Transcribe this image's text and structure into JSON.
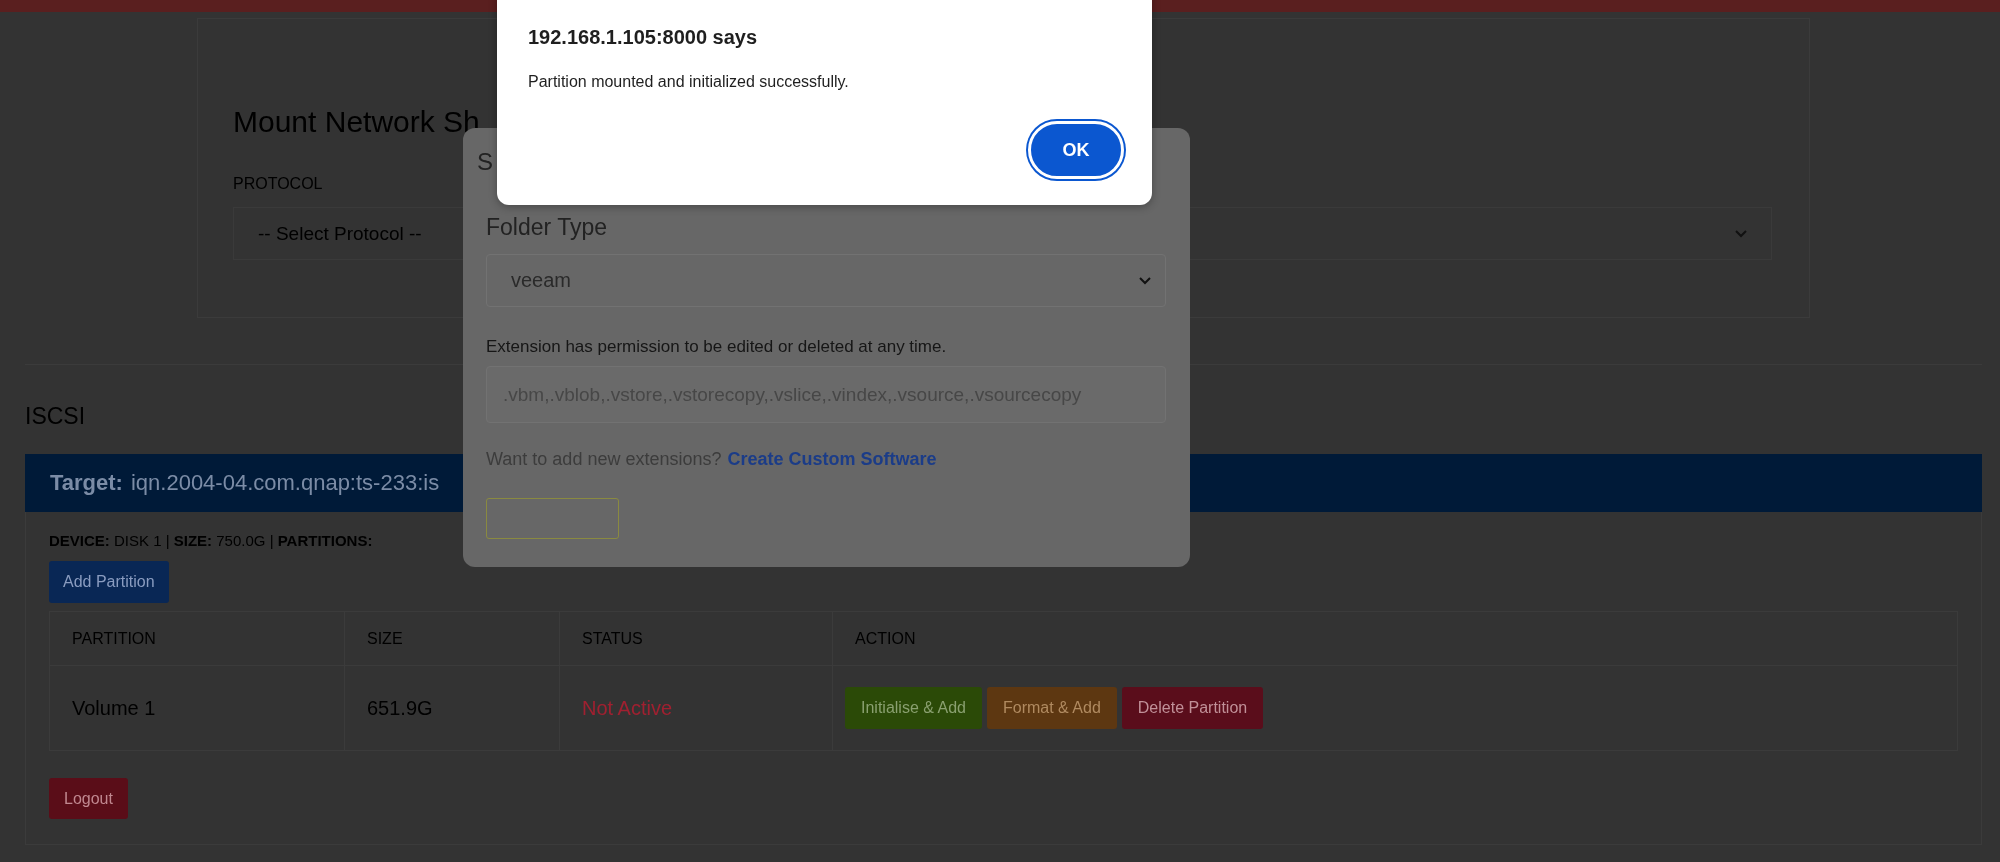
{
  "mount": {
    "title": "Mount Network Sh",
    "protocol_label": "PROTOCOL",
    "protocol_value": "-- Select Protocol --"
  },
  "iscsi": {
    "heading": "ISCSI",
    "target_label": "Target:",
    "target_value": "iqn.2004-04.com.qnap:ts-233:is",
    "device_info": "**DEVICE:** DISK 1 | **SIZE:** 750.0G | **PARTITIONS:**",
    "add_button": "Add Partition",
    "columns": [
      "PARTITION",
      "SIZE",
      "STATUS",
      "ACTION"
    ],
    "rows": [
      {
        "partition": "Volume 1",
        "size": "651.9G",
        "status": "Not Active",
        "active": false,
        "actions": [
          {
            "label": "Initialise & Add",
            "kind": "initialise"
          },
          {
            "label": "Format & Add",
            "kind": "format"
          },
          {
            "label": "Delete Partition",
            "kind": "delete"
          }
        ]
      }
    ]
  },
  "logout": "Logout",
  "modal": {
    "title": "S",
    "folder_type_label": "Folder Type",
    "folder_type_value": "veeam",
    "extension_note": "Extension has permission to be edited or deleted at any time.",
    "extensions": ".vbm,.vblob,.vstore,.vstorecopy,.vslice,.vindex,.vsource,.vsourcecopy",
    "prompt": "Want to add new extensions?",
    "link": "Create Custom Software"
  },
  "alert": {
    "origin": "192.168.1.105:8000 says",
    "message": "Partition mounted and initialized successfully.",
    "button": "OK"
  }
}
